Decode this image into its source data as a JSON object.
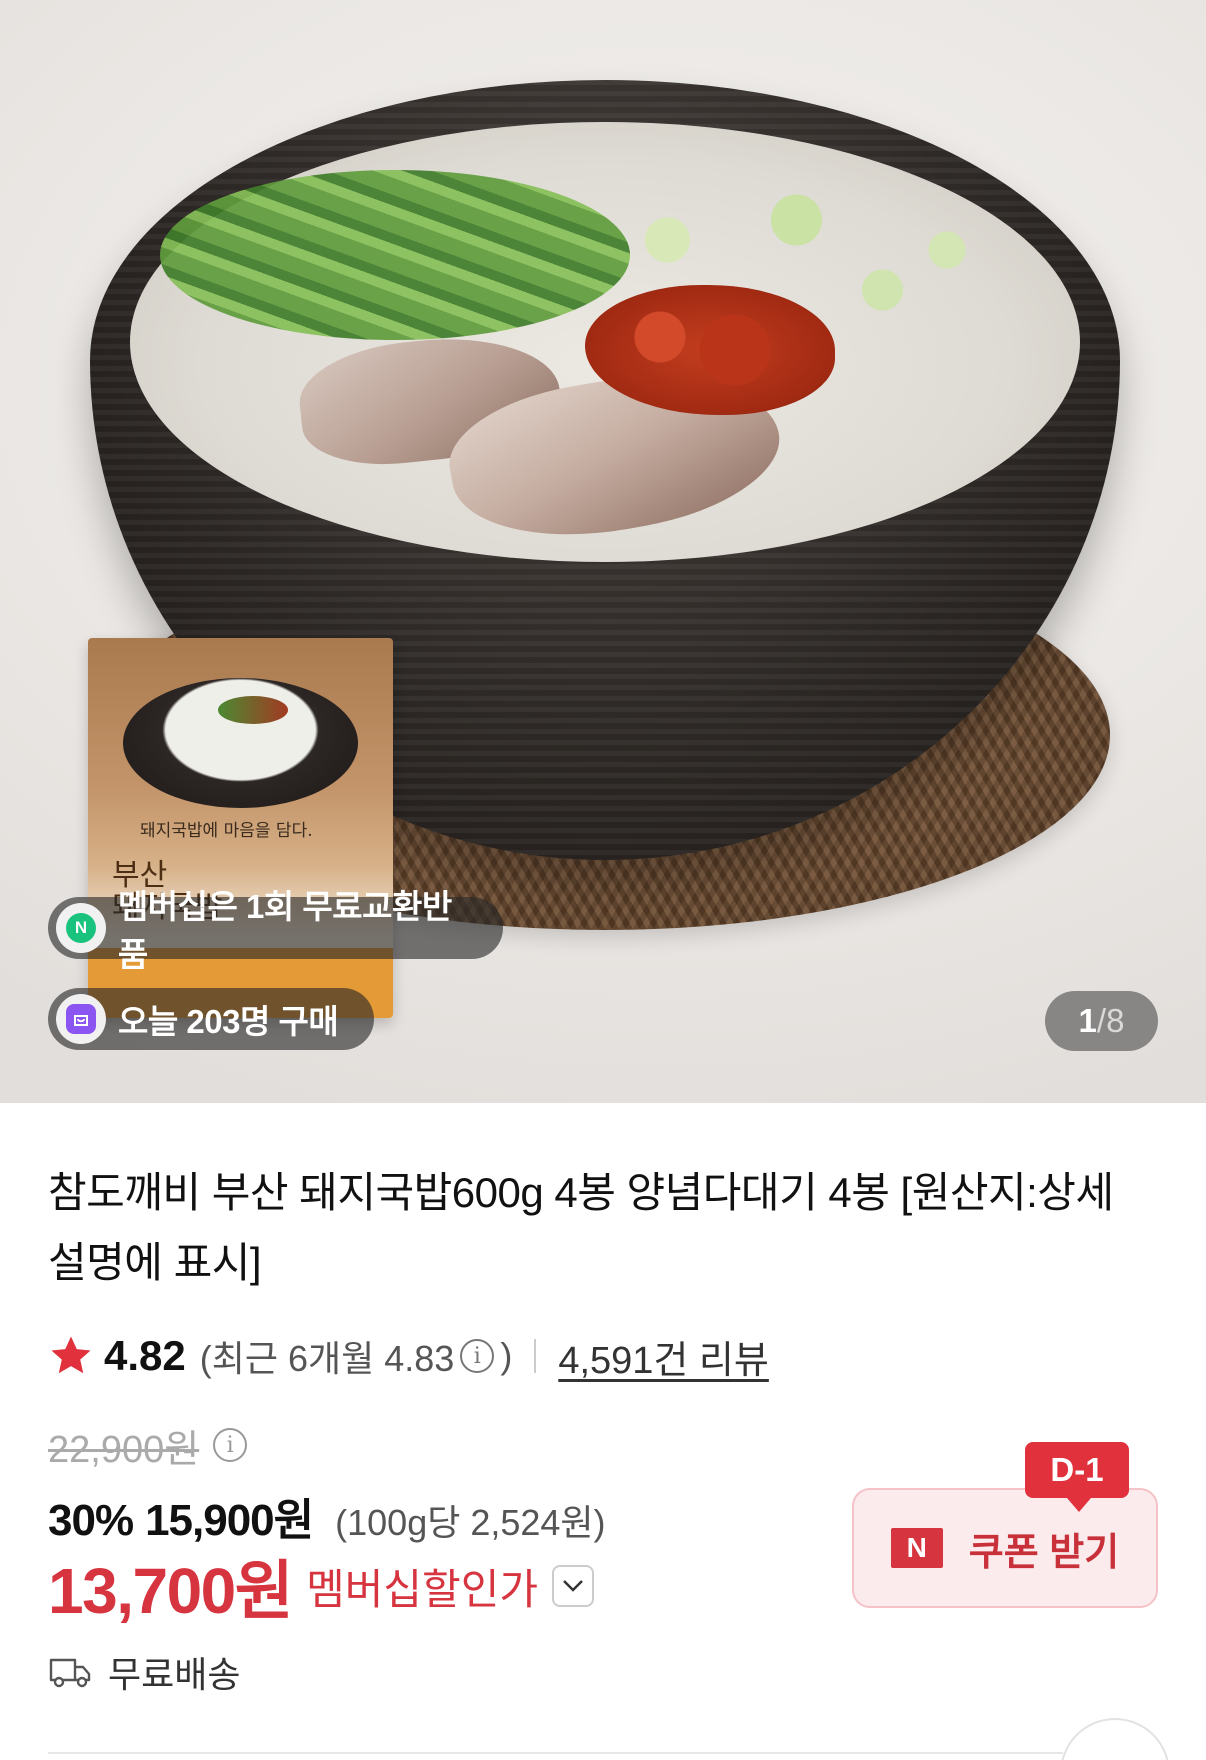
{
  "hero": {
    "badges": [
      {
        "text": "멤버십은 1회 무료교환반품",
        "icon": "n-membership-icon"
      },
      {
        "text": "오늘 203명 구매",
        "icon": "shopping-bag-icon"
      }
    ],
    "counter": {
      "current": "1",
      "separator": "/",
      "total": "8"
    },
    "package": {
      "tagline": "돼지국밥에 마음을 담다.",
      "name": "부산\n돼지국밥"
    }
  },
  "product": {
    "title": "참도깨비 부산 돼지국밥600g 4봉 양념다대기 4봉 [원산지:상세설명에 표시]",
    "rating": {
      "value": "4.82",
      "recent_prefix": "(최근 6개월 4.83",
      "recent_suffix": ")",
      "reviews": "4,591건 리뷰"
    },
    "price": {
      "original": "22,900원",
      "discount_rate": "30%",
      "sale": "15,900원",
      "unit_price": "(100g당 2,524원)",
      "member_price": "13,700원",
      "member_label": "멤버십할인가"
    },
    "coupon": {
      "dday": "D-1",
      "n_mark": "N",
      "label": "쿠폰 받기"
    },
    "shipping": "무료배송"
  },
  "colors": {
    "accent_red": "#d6343f",
    "coupon_bg": "#fcebed",
    "star": "#e0313d"
  }
}
